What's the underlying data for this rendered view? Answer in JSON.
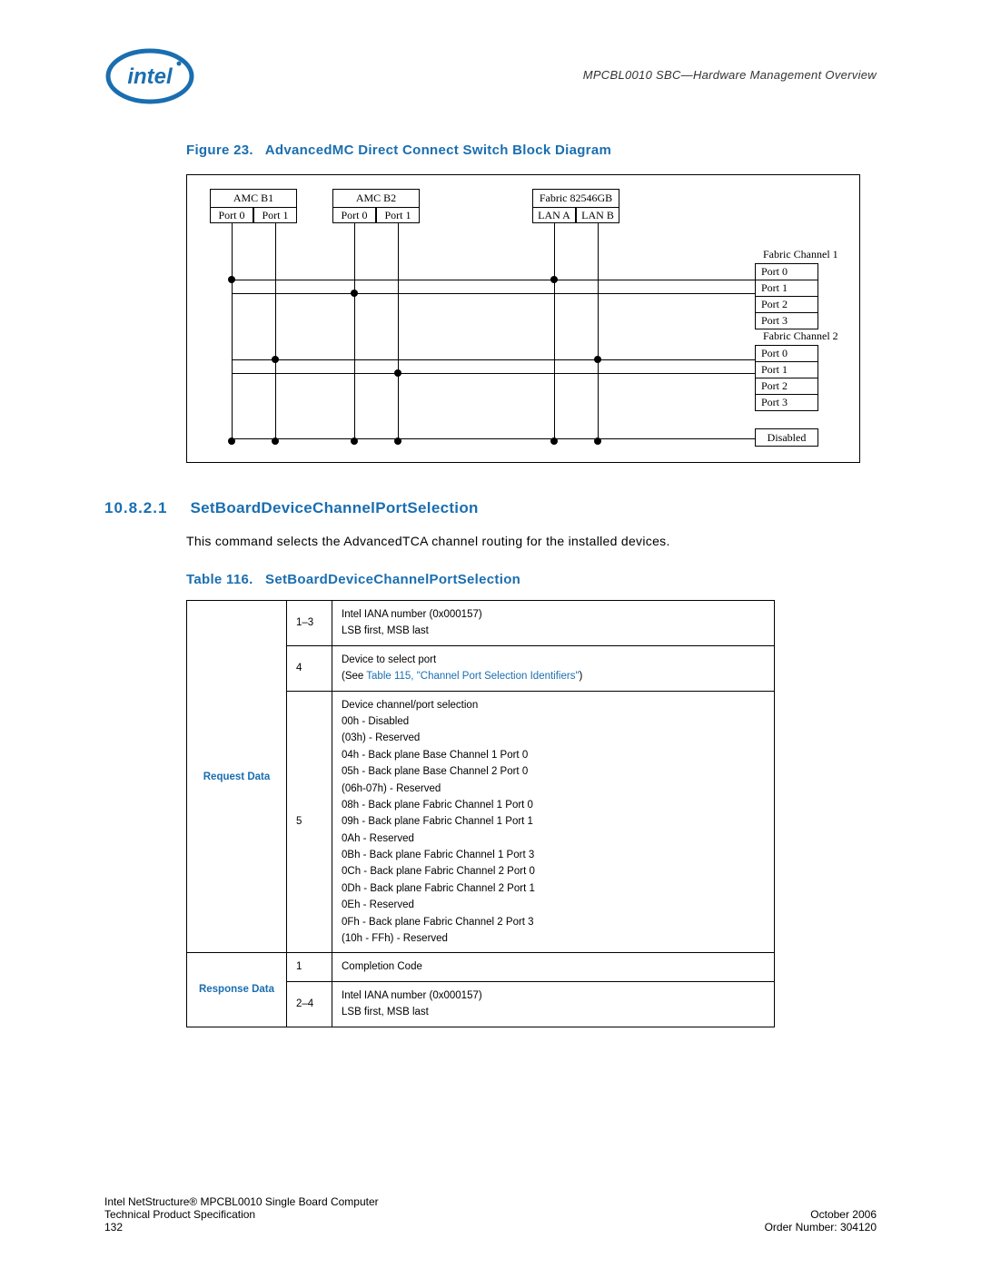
{
  "header": {
    "doc_title": "MPCBL0010 SBC—Hardware Management Overview"
  },
  "figure": {
    "caption_prefix": "Figure 23.",
    "caption_title": "AdvancedMC Direct Connect Switch Block Diagram",
    "amc_b1": "AMC B1",
    "amc_b2": "AMC B2",
    "fabric_chip": "Fabric 82546GB",
    "port0": "Port  0",
    "port1": "Port  1",
    "lan_a": "LAN A",
    "lan_b": "LAN B",
    "fc1_label": "Fabric Channel 1",
    "fc2_label": "Fabric Channel 2",
    "pt_p0": "Port  0",
    "pt_p1": "Port  1",
    "pt_p2": "Port  2",
    "pt_p3": "Port  3",
    "disabled": "Disabled"
  },
  "section": {
    "number": "10.8.2.1",
    "title": "SetBoardDeviceChannelPortSelection",
    "body": "This command selects the AdvancedTCA channel routing for the installed devices."
  },
  "table": {
    "caption_prefix": "Table 116.",
    "caption_title": "SetBoardDeviceChannelPortSelection",
    "request_label": "Request Data",
    "response_label": "Response Data",
    "row1_bytes": "1–3",
    "row1_text_l1": "Intel IANA number (0x000157)",
    "row1_text_l2": "LSB first, MSB last",
    "row2_bytes": "4",
    "row2_text_l1": "Device to select port",
    "row2_text_l2a": "(See ",
    "row2_text_l2b": "Table 115, \"Channel Port Selection Identifiers\"",
    "row2_text_l2c": ")",
    "row3_bytes": "5",
    "row3_lines": [
      "Device channel/port selection",
      "00h - Disabled",
      "(03h) - Reserved",
      "04h - Back plane Base Channel 1 Port 0",
      "05h - Back plane Base Channel 2 Port 0",
      "(06h-07h) - Reserved",
      "08h - Back plane Fabric Channel 1 Port 0",
      "09h - Back plane Fabric Channel 1 Port 1",
      "0Ah - Reserved",
      "0Bh - Back plane Fabric Channel 1 Port 3",
      "0Ch - Back plane Fabric Channel 2 Port 0",
      "0Dh - Back plane Fabric Channel 2 Port 1",
      "0Eh - Reserved",
      "0Fh - Back plane Fabric Channel 2 Port 3",
      "(10h - FFh) - Reserved"
    ],
    "resp_row1_bytes": "1",
    "resp_row1_text": "Completion Code",
    "resp_row2_bytes": "2–4",
    "resp_row2_text_l1": "Intel IANA number (0x000157)",
    "resp_row2_text_l2": "LSB first, MSB last"
  },
  "footer": {
    "l1_left": "Intel NetStructure® MPCBL0010 Single Board Computer",
    "l2_left": "Technical Product Specification",
    "l2_right": "October 2006",
    "l3_left": "132",
    "l3_right": "Order Number: 304120"
  }
}
